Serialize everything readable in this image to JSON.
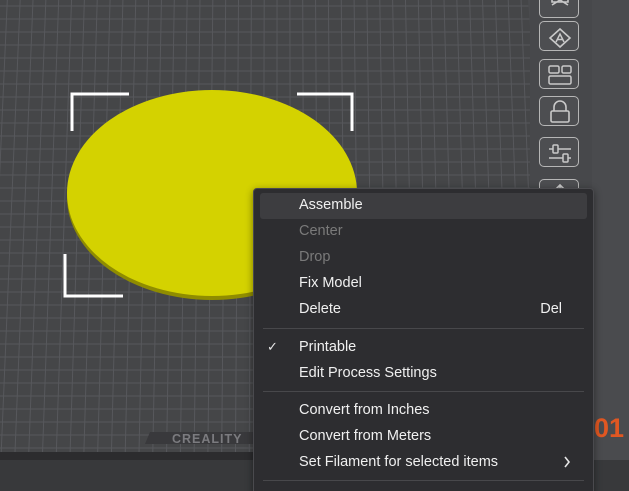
{
  "bed": {
    "brand_label": "CREALITY"
  },
  "accent_text": "01",
  "colors": {
    "model": "#d4d200",
    "bed": "#454648",
    "grid": "#55565a",
    "menu_bg": "#2d2d30",
    "accent": "#e05722"
  },
  "toolbar": {
    "tools": [
      {
        "icon": "arrange-icon"
      },
      {
        "icon": "orient-icon"
      },
      {
        "icon": "layout-icon"
      },
      {
        "icon": "lock-icon"
      },
      {
        "icon": "sliders-icon"
      },
      {
        "icon": "export-icon"
      }
    ]
  },
  "context_menu": {
    "items": [
      {
        "label": "Assemble",
        "state": "hover"
      },
      {
        "label": "Center",
        "state": "disabled"
      },
      {
        "label": "Drop",
        "state": "disabled"
      },
      {
        "label": "Fix Model"
      },
      {
        "label": "Delete",
        "shortcut": "Del"
      },
      {
        "label": "Printable",
        "checked": true
      },
      {
        "label": "Edit Process Settings"
      },
      {
        "label": "Convert from Inches"
      },
      {
        "label": "Convert from Meters"
      },
      {
        "label": "Set Filament for selected items",
        "has_submenu": true
      }
    ]
  }
}
